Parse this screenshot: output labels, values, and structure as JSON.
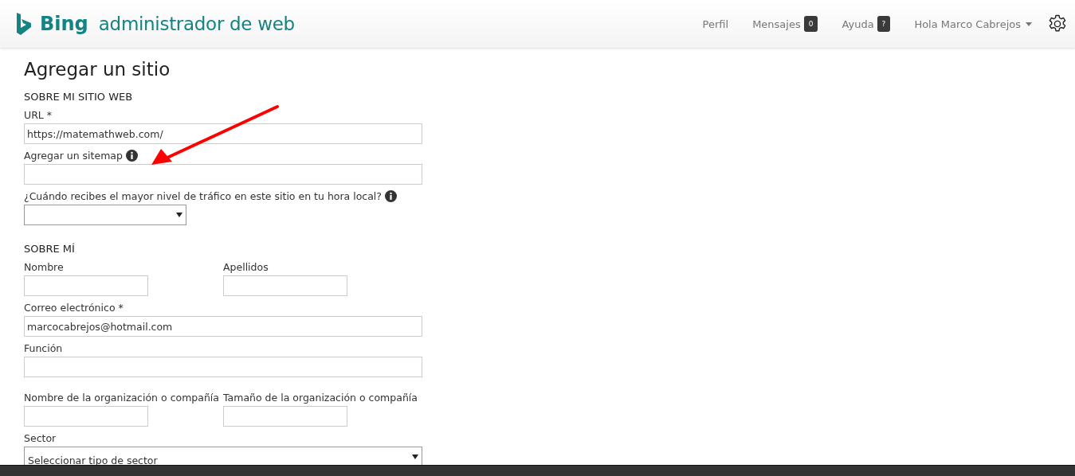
{
  "header": {
    "logo_text": "Bing",
    "subtitle": "administrador de web",
    "nav": [
      {
        "label": "Perfil"
      },
      {
        "label": "Mensajes",
        "badge": "0"
      },
      {
        "label": "Ayuda",
        "badge": "?"
      }
    ],
    "user_menu": "Hola Marco Cabrejos"
  },
  "page_title": "Agregar un sitio",
  "sections": [
    {
      "heading": "SOBRE MI SITIO WEB",
      "rows": [
        [
          {
            "kind": "text",
            "label": "URL *",
            "value": "https://matemathweb.com/"
          }
        ],
        [
          {
            "kind": "text",
            "label": "Agregar un sitemap",
            "info": true
          }
        ],
        [
          {
            "kind": "short-select",
            "label": "¿Cuándo recibes el mayor nivel de tráfico en este sitio en tu hora local?",
            "info": true
          }
        ]
      ]
    },
    {
      "heading": "SOBRE MÍ",
      "rows": [
        [
          {
            "kind": "text",
            "label": "Nombre"
          },
          {
            "kind": "text",
            "label": "Apellidos"
          }
        ],
        [
          {
            "kind": "text",
            "label": "Correo electrónico *",
            "value": "marcocabrejos@hotmail.com"
          }
        ],
        [
          {
            "kind": "text",
            "label": "Función"
          }
        ],
        [
          {
            "kind": "text",
            "label": "Nombre de la organización o compañía"
          },
          {
            "kind": "text",
            "label": "Tamaño de la organización o compañía"
          }
        ],
        [
          {
            "kind": "select",
            "label": "Sector",
            "value": "Seleccionar tipo de sector"
          }
        ]
      ]
    }
  ]
}
